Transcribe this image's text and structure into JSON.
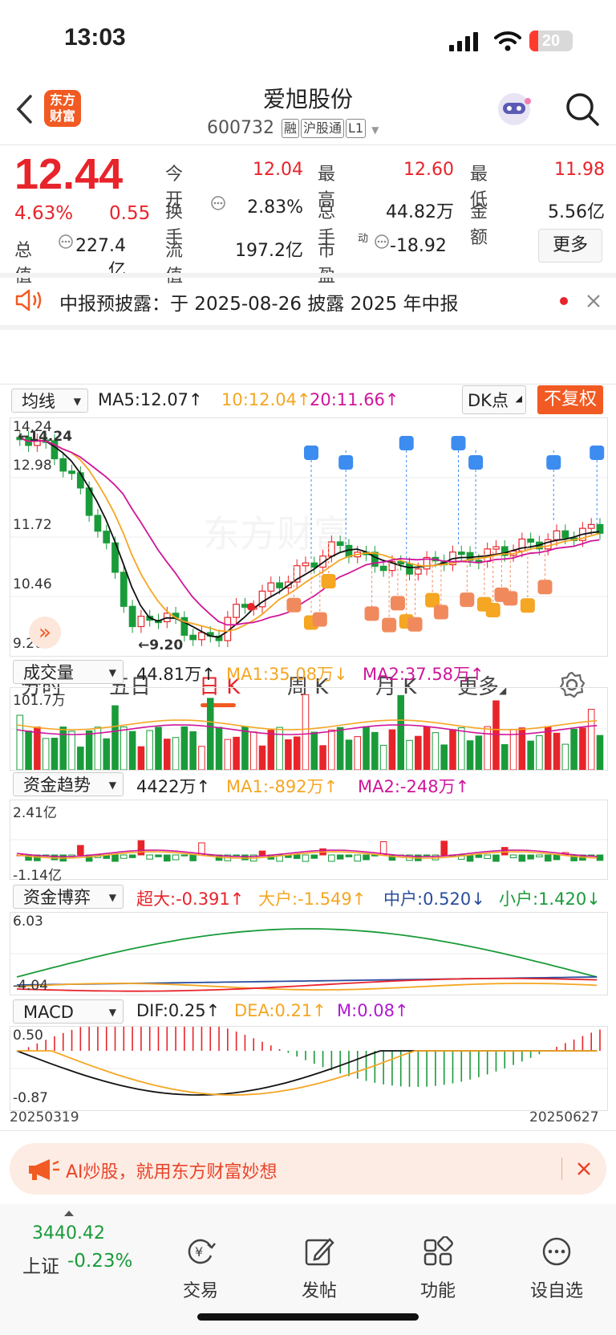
{
  "status_bar": {
    "time": "13:03",
    "battery": "20"
  },
  "header": {
    "back_icon": "chevron-left-icon",
    "logo_line1": "东方",
    "logo_line2": "财富",
    "stock_name": "爱旭股份",
    "stock_code": "600732",
    "tags": [
      "融",
      "沪股通",
      "L1"
    ],
    "assistant_icon": "robot-avatar-icon",
    "search_icon": "search-icon"
  },
  "quote": {
    "price": "12.44",
    "change_pct": "4.63%",
    "change_amt": "0.55",
    "rows": [
      [
        {
          "label": "今开",
          "value": "12.04"
        },
        {
          "label": "最高",
          "value": "12.60"
        },
        {
          "label": "最低",
          "value": "11.98"
        }
      ],
      [
        {
          "label": "换手",
          "value": "2.83%"
        },
        {
          "label": "总手",
          "value": "44.82万"
        },
        {
          "label": "金额",
          "value": "5.56亿"
        }
      ],
      [
        {
          "label": "流值",
          "value": "197.2亿"
        },
        {
          "label": "市盈",
          "value": "-18.92"
        }
      ]
    ],
    "total_value_label": "总值",
    "total_value": "227.4亿",
    "pe_sup": "动",
    "more_button": "更多"
  },
  "notice": {
    "text": "中报预披露：于 2025-08-26 披露 2025 年中报",
    "speaker_icon": "speaker-icon",
    "close_icon": "close-icon"
  },
  "tabs": {
    "items": [
      "分时",
      "五日",
      "日 K",
      "周 K",
      "月 K",
      "更多"
    ],
    "active": "日 K",
    "settings_icon": "gear-icon"
  },
  "kline": {
    "indicator_select": "均线",
    "ma5": "MA5:12.07",
    "ma10": "10:12.04",
    "ma20": "20:11.66",
    "arrow": "↑",
    "dk_button": "DK点",
    "adjust_button": "不复权",
    "axis": [
      "14.24",
      "12.98",
      "11.72",
      "10.46",
      "9.20"
    ],
    "high_mark": "←14.24",
    "low_mark": "←9.20",
    "watermark": "东方财富"
  },
  "volume": {
    "select": "成交量",
    "value": "44.81万",
    "ma1": "MA1:35.08万",
    "ma2": "MA2:37.58万",
    "axis_top": "101.7万",
    "ma1_arrow": "↓",
    "ma2_arrow": "↑"
  },
  "fund_trend": {
    "select": "资金趋势",
    "value": "4422万",
    "ma1": "MA1:-892万",
    "ma2": "MA2:-248万",
    "axis_top": "2.41亿",
    "axis_bottom": "-1.14亿"
  },
  "fund_game": {
    "select": "资金博弈",
    "super": "超大:-0.391",
    "large": "大户:-1.549",
    "mid": "中户:0.520",
    "small": "小户:1.420",
    "axis_top": "6.03",
    "axis_bottom": "-4.04",
    "mid_arrow": "↓",
    "small_arrow": "↓"
  },
  "macd": {
    "select": "MACD",
    "dif": "DIF:0.25",
    "dea": "DEA:0.21",
    "m": "M:0.08",
    "axis_top": "0.50",
    "axis_bottom": "-0.87",
    "date_start": "20250319",
    "date_end": "20250627"
  },
  "banner": {
    "text": "AI炒股，就用东方财富妙想",
    "megaphone_icon": "megaphone-icon",
    "close_icon": "close-icon"
  },
  "bottom_nav": {
    "index_value": "3440.42",
    "index_name": "上证",
    "index_change": "-0.23%",
    "items": [
      {
        "label": "交易",
        "icon": "trade-icon"
      },
      {
        "label": "发帖",
        "icon": "edit-icon"
      },
      {
        "label": "功能",
        "icon": "apps-icon"
      },
      {
        "label": "设自选",
        "icon": "more-icon"
      }
    ]
  },
  "colors": {
    "up": "#e8242b",
    "down": "#1a9b3a",
    "ma5": "#111111",
    "ma10": "#f5a623",
    "ma20": "#d0159a",
    "accent": "#f15a22"
  }
}
